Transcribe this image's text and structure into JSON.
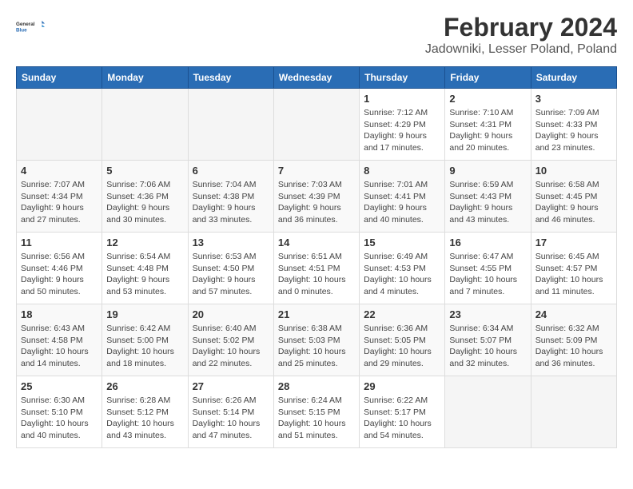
{
  "logo": {
    "general": "General",
    "blue": "Blue"
  },
  "title": "February 2024",
  "subtitle": "Jadowniki, Lesser Poland, Poland",
  "headers": [
    "Sunday",
    "Monday",
    "Tuesday",
    "Wednesday",
    "Thursday",
    "Friday",
    "Saturday"
  ],
  "rows": [
    [
      {
        "day": "",
        "info": ""
      },
      {
        "day": "",
        "info": ""
      },
      {
        "day": "",
        "info": ""
      },
      {
        "day": "",
        "info": ""
      },
      {
        "day": "1",
        "info": "Sunrise: 7:12 AM\nSunset: 4:29 PM\nDaylight: 9 hours\nand 17 minutes."
      },
      {
        "day": "2",
        "info": "Sunrise: 7:10 AM\nSunset: 4:31 PM\nDaylight: 9 hours\nand 20 minutes."
      },
      {
        "day": "3",
        "info": "Sunrise: 7:09 AM\nSunset: 4:33 PM\nDaylight: 9 hours\nand 23 minutes."
      }
    ],
    [
      {
        "day": "4",
        "info": "Sunrise: 7:07 AM\nSunset: 4:34 PM\nDaylight: 9 hours\nand 27 minutes."
      },
      {
        "day": "5",
        "info": "Sunrise: 7:06 AM\nSunset: 4:36 PM\nDaylight: 9 hours\nand 30 minutes."
      },
      {
        "day": "6",
        "info": "Sunrise: 7:04 AM\nSunset: 4:38 PM\nDaylight: 9 hours\nand 33 minutes."
      },
      {
        "day": "7",
        "info": "Sunrise: 7:03 AM\nSunset: 4:39 PM\nDaylight: 9 hours\nand 36 minutes."
      },
      {
        "day": "8",
        "info": "Sunrise: 7:01 AM\nSunset: 4:41 PM\nDaylight: 9 hours\nand 40 minutes."
      },
      {
        "day": "9",
        "info": "Sunrise: 6:59 AM\nSunset: 4:43 PM\nDaylight: 9 hours\nand 43 minutes."
      },
      {
        "day": "10",
        "info": "Sunrise: 6:58 AM\nSunset: 4:45 PM\nDaylight: 9 hours\nand 46 minutes."
      }
    ],
    [
      {
        "day": "11",
        "info": "Sunrise: 6:56 AM\nSunset: 4:46 PM\nDaylight: 9 hours\nand 50 minutes."
      },
      {
        "day": "12",
        "info": "Sunrise: 6:54 AM\nSunset: 4:48 PM\nDaylight: 9 hours\nand 53 minutes."
      },
      {
        "day": "13",
        "info": "Sunrise: 6:53 AM\nSunset: 4:50 PM\nDaylight: 9 hours\nand 57 minutes."
      },
      {
        "day": "14",
        "info": "Sunrise: 6:51 AM\nSunset: 4:51 PM\nDaylight: 10 hours\nand 0 minutes."
      },
      {
        "day": "15",
        "info": "Sunrise: 6:49 AM\nSunset: 4:53 PM\nDaylight: 10 hours\nand 4 minutes."
      },
      {
        "day": "16",
        "info": "Sunrise: 6:47 AM\nSunset: 4:55 PM\nDaylight: 10 hours\nand 7 minutes."
      },
      {
        "day": "17",
        "info": "Sunrise: 6:45 AM\nSunset: 4:57 PM\nDaylight: 10 hours\nand 11 minutes."
      }
    ],
    [
      {
        "day": "18",
        "info": "Sunrise: 6:43 AM\nSunset: 4:58 PM\nDaylight: 10 hours\nand 14 minutes."
      },
      {
        "day": "19",
        "info": "Sunrise: 6:42 AM\nSunset: 5:00 PM\nDaylight: 10 hours\nand 18 minutes."
      },
      {
        "day": "20",
        "info": "Sunrise: 6:40 AM\nSunset: 5:02 PM\nDaylight: 10 hours\nand 22 minutes."
      },
      {
        "day": "21",
        "info": "Sunrise: 6:38 AM\nSunset: 5:03 PM\nDaylight: 10 hours\nand 25 minutes."
      },
      {
        "day": "22",
        "info": "Sunrise: 6:36 AM\nSunset: 5:05 PM\nDaylight: 10 hours\nand 29 minutes."
      },
      {
        "day": "23",
        "info": "Sunrise: 6:34 AM\nSunset: 5:07 PM\nDaylight: 10 hours\nand 32 minutes."
      },
      {
        "day": "24",
        "info": "Sunrise: 6:32 AM\nSunset: 5:09 PM\nDaylight: 10 hours\nand 36 minutes."
      }
    ],
    [
      {
        "day": "25",
        "info": "Sunrise: 6:30 AM\nSunset: 5:10 PM\nDaylight: 10 hours\nand 40 minutes."
      },
      {
        "day": "26",
        "info": "Sunrise: 6:28 AM\nSunset: 5:12 PM\nDaylight: 10 hours\nand 43 minutes."
      },
      {
        "day": "27",
        "info": "Sunrise: 6:26 AM\nSunset: 5:14 PM\nDaylight: 10 hours\nand 47 minutes."
      },
      {
        "day": "28",
        "info": "Sunrise: 6:24 AM\nSunset: 5:15 PM\nDaylight: 10 hours\nand 51 minutes."
      },
      {
        "day": "29",
        "info": "Sunrise: 6:22 AM\nSunset: 5:17 PM\nDaylight: 10 hours\nand 54 minutes."
      },
      {
        "day": "",
        "info": ""
      },
      {
        "day": "",
        "info": ""
      }
    ]
  ]
}
